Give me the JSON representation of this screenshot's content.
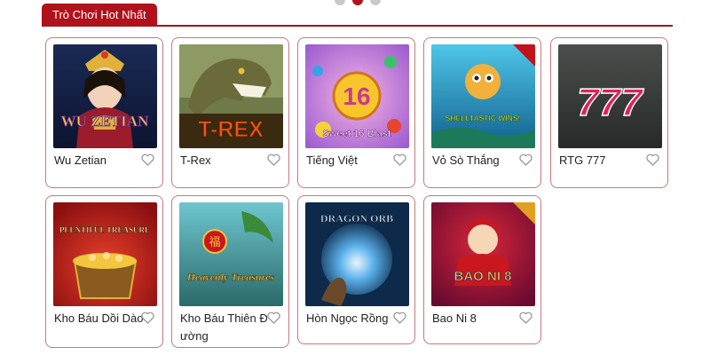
{
  "section": {
    "title": "Trò Chơi Hot Nhất"
  },
  "carousel": {
    "dot_count": 3,
    "active_index": 1
  },
  "games": [
    {
      "name": "Wu Zetian",
      "art": "WU ZETIAN"
    },
    {
      "name": "T-Rex",
      "art": "T-REX"
    },
    {
      "name": "Tiếng Việt",
      "art": "Sweet 16 Blast"
    },
    {
      "name": "Vỏ Sò Thắng",
      "art": "SHELLTASTIC WINS!"
    },
    {
      "name": "RTG 777",
      "art": "777"
    },
    {
      "name": "Kho Báu Dồi Dào",
      "art": "PLENTIFUL TREASURE"
    },
    {
      "name": "Kho Báu Thiên Đường",
      "art": "Heavenly Treasures"
    },
    {
      "name": "Hòn Ngọc Rồng",
      "art": "DRAGON ORB"
    },
    {
      "name": "Bao Ni 8",
      "art": "BAO NI 8"
    }
  ],
  "colors": {
    "accent": "#b0121b",
    "card_border": "#c7797d",
    "dot_inactive": "#c9c9c9"
  }
}
